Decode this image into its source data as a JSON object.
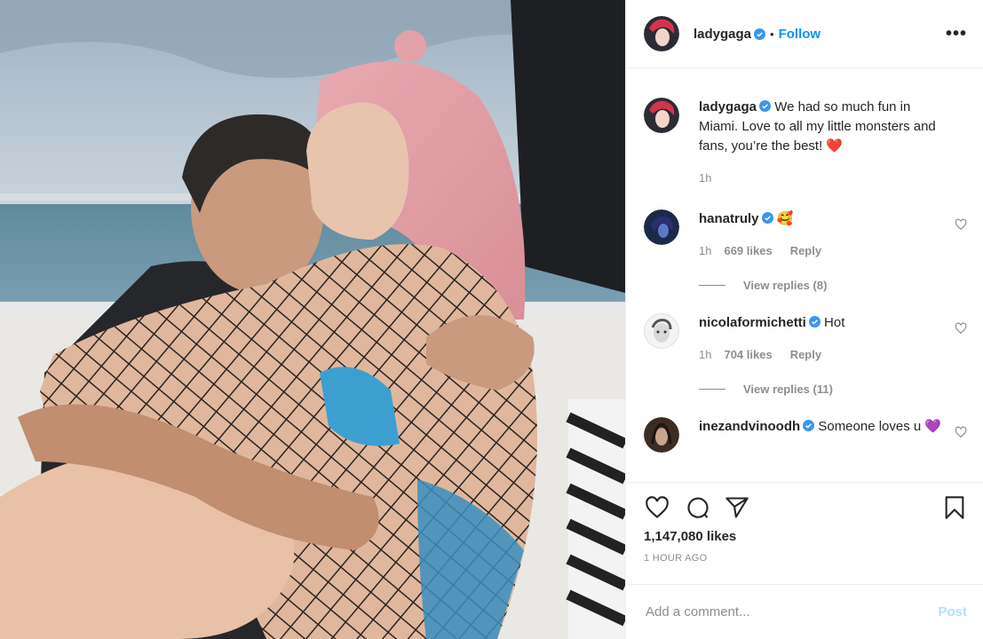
{
  "post": {
    "author": "ladygaga",
    "follow_label": "Follow",
    "separator": "•",
    "more_label": "•••",
    "photo_alt": "photo"
  },
  "caption": {
    "author": "ladygaga",
    "text": "We had so much fun in Miami. Love to all my little monsters and fans, you’re the best! ❤️",
    "time": "1h"
  },
  "comments": [
    {
      "author": "hanatruly",
      "text": "🥰",
      "time": "1h",
      "likes": "669 likes",
      "reply_label": "Reply",
      "view_replies": "View replies (8)"
    },
    {
      "author": "nicolaformichetti",
      "text": "Hot",
      "time": "1h",
      "likes": "704 likes",
      "reply_label": "Reply",
      "view_replies": "View replies (11)"
    },
    {
      "author": "inezandvinoodh",
      "text": "Someone loves u 💜"
    }
  ],
  "actions": {
    "like_icon": "heart-icon",
    "comment_icon": "comment-icon",
    "share_icon": "share-icon",
    "save_icon": "bookmark-icon",
    "likes_count": "1,147,080 likes",
    "time_ago": "1 HOUR AGO"
  },
  "add_comment": {
    "placeholder": "Add a comment...",
    "post_label": "Post"
  },
  "colors": {
    "accent": "#0095f6",
    "post_disabled": "#b2dffc",
    "muted": "#8e8e8e"
  }
}
